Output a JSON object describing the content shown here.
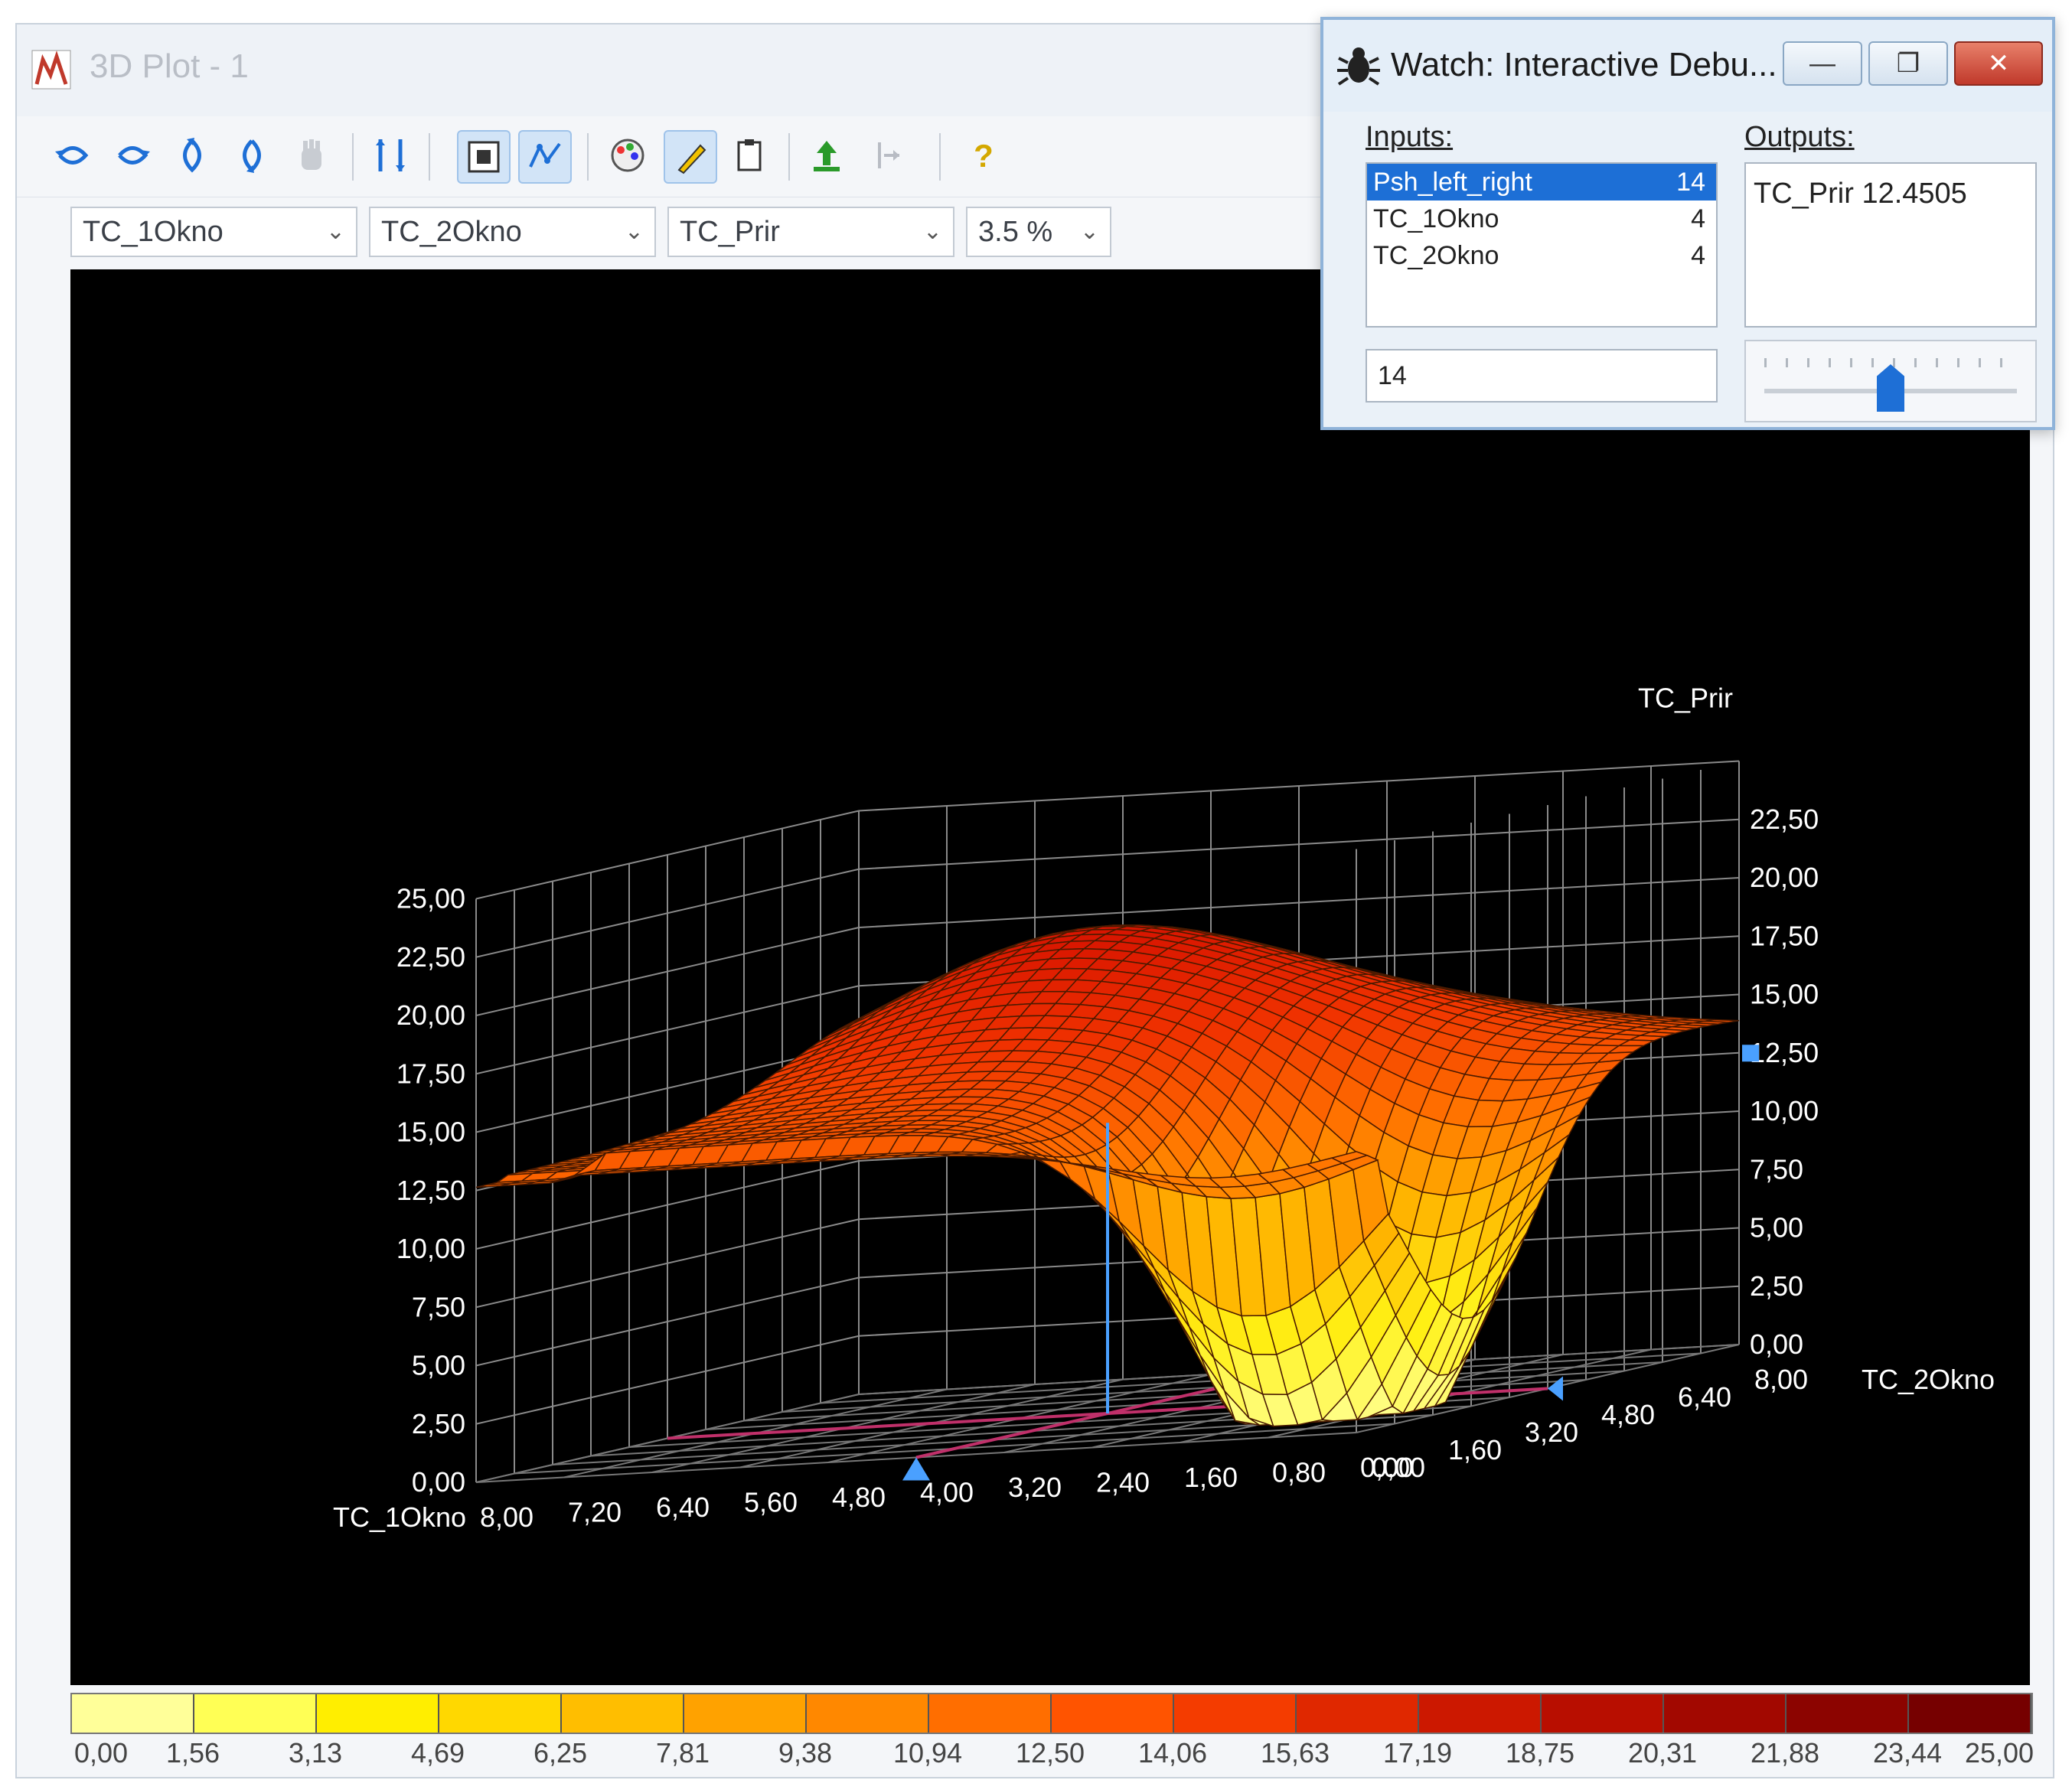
{
  "window": {
    "title": "3D Plot - 1"
  },
  "toolbar": {
    "buttons": [
      {
        "icon": "rotate-left-icon"
      },
      {
        "icon": "rotate-right-icon"
      },
      {
        "icon": "rotate-up-icon"
      },
      {
        "icon": "rotate-down-icon"
      },
      {
        "icon": "pan-hand-icon"
      },
      {
        "icon": "axis-scale-icon"
      },
      {
        "icon": "fit-view-icon",
        "active": true
      },
      {
        "icon": "trace-points-icon",
        "active": true
      },
      {
        "icon": "color-palette-icon"
      },
      {
        "icon": "pen-highlight-icon",
        "active": true
      },
      {
        "icon": "copy-clipboard-icon"
      },
      {
        "icon": "export-up-icon"
      },
      {
        "icon": "step-icon"
      },
      {
        "icon": "help-icon"
      }
    ]
  },
  "selectors": {
    "x_input": "TC_1Okno",
    "y_input": "TC_2Okno",
    "output": "TC_Prir",
    "resolution": "3.5 %"
  },
  "chart_data": {
    "type": "surface",
    "z_axis_label": "TC_Prir",
    "x_axis_label": "TC_1Okno",
    "y_axis_label": "TC_2Okno",
    "left_z_ticks": [
      "25,00",
      "22,50",
      "20,00",
      "17,50",
      "15,00",
      "12,50",
      "10,00",
      "7,50",
      "5,00",
      "2,50",
      "0,00"
    ],
    "right_z_ticks": [
      "22,50",
      "20,00",
      "17,50",
      "15,00",
      "12,50",
      "10,00",
      "7,50",
      "5,00",
      "2,50",
      "0,00"
    ],
    "x_ticks": [
      "8,00",
      "7,20",
      "6,40",
      "5,60",
      "4,80",
      "4,00",
      "3,20",
      "2,40",
      "1,60",
      "0,80",
      "0,00"
    ],
    "y_ticks": [
      "0,00",
      "1,60",
      "3,20",
      "4,80",
      "6,40",
      "8,00"
    ],
    "z_range": [
      0,
      25
    ],
    "x_range": [
      0,
      8
    ],
    "y_range": [
      0,
      8
    ],
    "cursor": {
      "x": 4,
      "y": 4,
      "z": 12.4505
    },
    "colorbar_ticks": [
      "0,00",
      "1,56",
      "3,13",
      "4,69",
      "6,25",
      "7,81",
      "9,38",
      "10,94",
      "12,50",
      "14,06",
      "15,63",
      "17,19",
      "18,75",
      "20,31",
      "21,88",
      "23,44",
      "25,00"
    ],
    "colorbar_colors": [
      "#ffff99",
      "#ffff55",
      "#ffee00",
      "#ffd800",
      "#ffbe00",
      "#ffa200",
      "#ff8800",
      "#ff6e00",
      "#ff5400",
      "#f43c00",
      "#e02800",
      "#cc1800",
      "#b80e00",
      "#a20800",
      "#8c0400",
      "#760000"
    ]
  },
  "watch": {
    "title": "Watch: Interactive Debu...",
    "inputs_label": "Inputs:",
    "outputs_label": "Outputs:",
    "inputs": [
      {
        "name": "Psh_left_right",
        "value": "14",
        "selected": true
      },
      {
        "name": "TC_1Okno",
        "value": "4"
      },
      {
        "name": "TC_2Okno",
        "value": "4"
      }
    ],
    "output_line": "TC_Prir  12.4505",
    "input_value": "14",
    "slider_value": 0.5
  }
}
